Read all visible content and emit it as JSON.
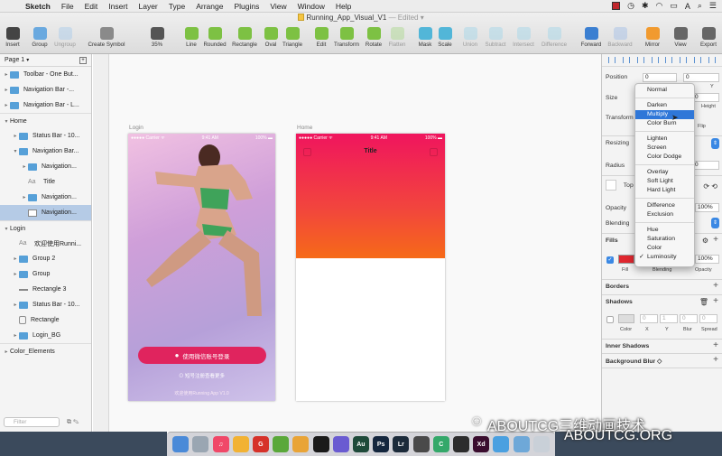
{
  "menubar": {
    "items": [
      "Sketch",
      "File",
      "Edit",
      "Insert",
      "Layer",
      "Type",
      "Arrange",
      "Plugins",
      "View",
      "Window",
      "Help"
    ],
    "flag_color": "#c0262c"
  },
  "toolbar": {
    "doc_title": "Running_App_Visual_V1",
    "doc_state": "— Edited ▾",
    "zoom": "35%",
    "buttons": [
      {
        "label": "Insert",
        "color": "#444"
      },
      {
        "label": "Group",
        "color": "#6aa9df"
      },
      {
        "label": "Ungroup",
        "color": "#a7c9ea"
      },
      {
        "label": "Create Symbol",
        "color": "#8a8a8a"
      },
      {
        "label": "35%",
        "color": "#555"
      },
      {
        "label": "Line",
        "color": "#7dc143"
      },
      {
        "label": "Rounded",
        "color": "#7dc143"
      },
      {
        "label": "Rectangle",
        "color": "#7dc143"
      },
      {
        "label": "Oval",
        "color": "#7dc143"
      },
      {
        "label": "Triangle",
        "color": "#7dc143"
      },
      {
        "label": "Edit",
        "color": "#7dc143"
      },
      {
        "label": "Transform",
        "color": "#7dc143"
      },
      {
        "label": "Rotate",
        "color": "#7dc143"
      },
      {
        "label": "Flatten",
        "color": "#a9d78a"
      },
      {
        "label": "Mask",
        "color": "#52b6d8"
      },
      {
        "label": "Scale",
        "color": "#52b6d8"
      },
      {
        "label": "Union",
        "color": "#9fd5e8"
      },
      {
        "label": "Subtract",
        "color": "#9fd5e8"
      },
      {
        "label": "Intersect",
        "color": "#9fd5e8"
      },
      {
        "label": "Difference",
        "color": "#9fd5e8"
      },
      {
        "label": "Forward",
        "color": "#3b7fd1"
      },
      {
        "label": "Backward",
        "color": "#9fbde6"
      },
      {
        "label": "Mirror",
        "color": "#f19a2f"
      },
      {
        "label": "View",
        "color": "#666"
      },
      {
        "label": "Export",
        "color": "#666"
      }
    ]
  },
  "layers": {
    "page": "Page 1",
    "filter_placeholder": "Filter",
    "items": [
      {
        "label": "Toolbar - One But...",
        "icon": "folder"
      },
      {
        "label": "Navigation Bar -...",
        "icon": "folder"
      },
      {
        "label": "Navigation Bar - L...",
        "icon": "folder"
      },
      {
        "label": "Home",
        "icon": "none"
      },
      {
        "label": "Status Bar - 10...",
        "icon": "folder"
      },
      {
        "label": "Navigation Bar...",
        "icon": "folder"
      },
      {
        "label": "Navigation...",
        "icon": "folder"
      },
      {
        "label": "Title",
        "icon": "txt"
      },
      {
        "label": "Navigation...",
        "icon": "folder"
      },
      {
        "label": "Navigation...",
        "icon": "rect"
      },
      {
        "label": "Login",
        "icon": "none"
      },
      {
        "label": "欢迎使用Runni...",
        "icon": "txt"
      },
      {
        "label": "Group 2",
        "icon": "folder"
      },
      {
        "label": "Group",
        "icon": "folder"
      },
      {
        "label": "Rectangle 3",
        "icon": "line"
      },
      {
        "label": "Status Bar - 10...",
        "icon": "folder"
      },
      {
        "label": "Rectangle",
        "icon": "sym"
      },
      {
        "label": "Login_BG",
        "icon": "folder"
      },
      {
        "label": "Color_Elements",
        "icon": "none"
      }
    ]
  },
  "canvas": {
    "login_label": "Login",
    "home_label": "Home",
    "carrier": "●●●●● Carrier ᯤ",
    "time": "9:41 AM",
    "battery": "100% ▬",
    "login_button": "使用微信账号登录",
    "login_link": "⊙ 短号注册查看更多",
    "login_copy": "欢迎使用Running App V1.0",
    "home_title": "Title"
  },
  "inspector": {
    "position_label": "Position",
    "position_x": "0",
    "position_y": "0",
    "size_label": "Size",
    "size_h": "0",
    "height_label": "Height",
    "y_label": "Y",
    "transform_label": "Transform",
    "flip_label": "Flip",
    "resizing_label": "Resizing",
    "radius_label": "Radius",
    "radius_value": "0",
    "top_label": "Top",
    "opacity_label": "Opacity",
    "opacity_value": "100%",
    "blending_label": "Blending",
    "fills_label": "Fills",
    "fill_opacity": "100%",
    "fill_color": "#e0272f",
    "fill_sub": "Fill",
    "blending_sub": "Blending",
    "opacity_sub": "Opacity",
    "borders_label": "Borders",
    "shadows_label": "Shadows",
    "shadow_vals": [
      "0",
      "1",
      "0",
      "0"
    ],
    "shadow_subs": [
      "Color",
      "X",
      "Y",
      "Blur",
      "Spread"
    ],
    "inner_shadows_label": "Inner Shadows",
    "bg_blur_label": "Background Blur ◇"
  },
  "blend_menu": {
    "groups": [
      [
        "Normal"
      ],
      [
        "Darken",
        "Multiply",
        "Color Burn"
      ],
      [
        "Lighten",
        "Screen",
        "Color Dodge"
      ],
      [
        "Overlay",
        "Soft Light",
        "Hard Light"
      ],
      [
        "Difference",
        "Exclusion"
      ],
      [
        "Hue",
        "Saturation",
        "Color",
        "Luminosity"
      ]
    ],
    "highlighted": "Multiply",
    "checked": "Luminosity"
  },
  "dock": {
    "apps": [
      {
        "label": "",
        "color": "#4a8ad8"
      },
      {
        "label": "",
        "color": "#9aa6b2"
      },
      {
        "label": "♫",
        "color": "#f04868"
      },
      {
        "label": "",
        "color": "#f2b233"
      },
      {
        "label": "G",
        "color": "#d6322a"
      },
      {
        "label": "",
        "color": "#5aa83a"
      },
      {
        "label": "",
        "color": "#e9a437"
      },
      {
        "label": "",
        "color": "#1a1a1a"
      },
      {
        "label": "",
        "color": "#6a5bd1"
      },
      {
        "label": "Au",
        "color": "#1f4a3a"
      },
      {
        "label": "Ps",
        "color": "#14263d"
      },
      {
        "label": "Lr",
        "color": "#1c2b3a"
      },
      {
        "label": "",
        "color": "#4a4a4a"
      },
      {
        "label": "C",
        "color": "#34a86a"
      },
      {
        "label": "",
        "color": "#2d2d2d"
      },
      {
        "label": "Xd",
        "color": "#3a0d2e"
      },
      {
        "label": "",
        "color": "#4aa0e0"
      },
      {
        "label": "",
        "color": "#6ea8d8"
      },
      {
        "label": "",
        "color": "#c9d0d8"
      }
    ]
  },
  "watermark": {
    "line1": "ABOUTCG三维动画技术",
    "line2": "ABOUTCG.ORG"
  }
}
